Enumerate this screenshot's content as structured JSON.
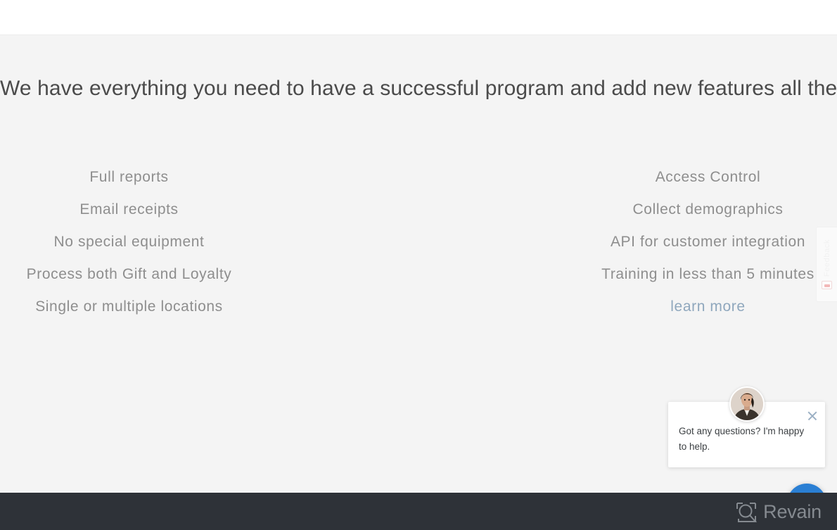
{
  "page": {
    "background_color": "#f4f4f4",
    "headline": "We have everything you need to have a successful program and add new features all the time..."
  },
  "topbar": {
    "background_color": "#ffffff"
  },
  "features": {
    "left_column": [
      "Full reports",
      "Email receipts",
      "No special equipment",
      "Process both Gift and Loyalty",
      "Single or multiple locations"
    ],
    "right_column": [
      "Access Control",
      "Collect demographics",
      "API for customer integration",
      "Training in less than 5 minutes"
    ],
    "learn_more_label": "learn more",
    "learn_more_color": "#8fa7bd",
    "text_color": "#8e8e8e"
  },
  "feedback_tab": {
    "label": "Feedback",
    "icon": "feedback-face-icon"
  },
  "chat": {
    "message": "Got any questions? I'm happy to help.",
    "close_icon": "close-icon",
    "avatar_icon": "agent-avatar",
    "launcher_icon": "chat-bubbles-icon",
    "launcher_color": "#2a7fd4"
  },
  "footer": {
    "background_color": "#2e3238",
    "brand_name": "Revain",
    "brand_icon": "revain-logo-icon",
    "brand_color": "#858a90"
  }
}
